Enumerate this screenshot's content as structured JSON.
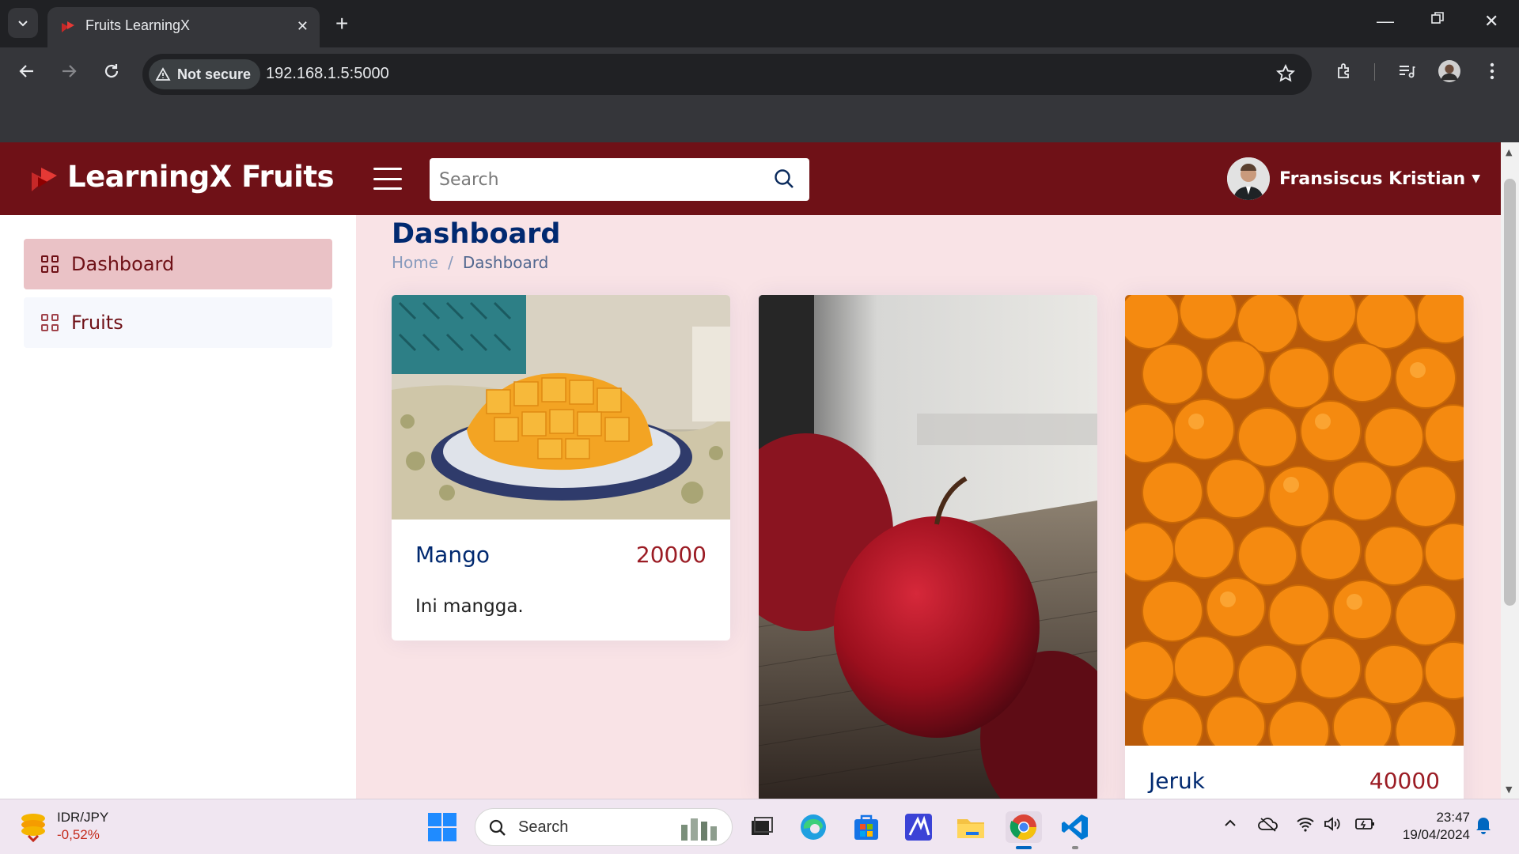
{
  "browser": {
    "tab_title": "Fruits LearningX",
    "security_label": "Not secure",
    "url": "192.168.1.5:5000"
  },
  "app": {
    "brand": "LearningX Fruits",
    "search_placeholder": "Search",
    "user_name": "Fransiscus Kristian",
    "accent_color": "#6f1117"
  },
  "sidebar": {
    "items": [
      {
        "label": "Dashboard",
        "active": true,
        "icon": "grid-icon"
      },
      {
        "label": "Fruits",
        "active": false,
        "icon": "grid-icon"
      }
    ]
  },
  "page": {
    "title": "Dashboard",
    "breadcrumb": [
      "Home",
      "/",
      "Dashboard"
    ]
  },
  "cards": [
    {
      "name": "Mango",
      "price": "20000",
      "description": "Ini mangga.",
      "image": "mango-photo"
    },
    {
      "name": "",
      "price": "",
      "description": "",
      "image": "apple-photo"
    },
    {
      "name": "Jeruk",
      "price": "40000",
      "description": "",
      "image": "oranges-photo"
    }
  ],
  "taskbar": {
    "widget_pair": "IDR/JPY",
    "widget_change": "-0,52%",
    "search_label": "Search",
    "time": "23:47",
    "date": "19/04/2024"
  }
}
